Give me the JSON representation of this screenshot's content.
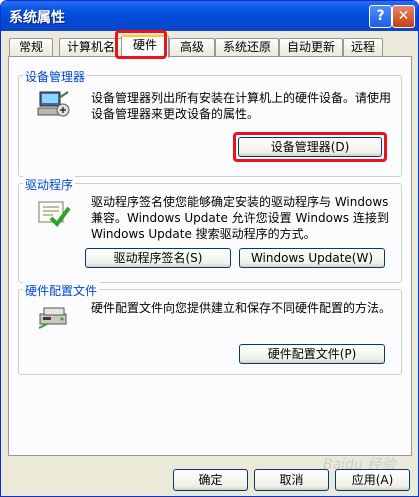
{
  "window": {
    "title": "系统属性",
    "help_glyph": "?",
    "close_glyph": "✕"
  },
  "tabs": [
    {
      "label": "常规",
      "active": false
    },
    {
      "label": "计算机名",
      "active": false
    },
    {
      "label": "硬件",
      "active": true
    },
    {
      "label": "高级",
      "active": false
    },
    {
      "label": "系统还原",
      "active": false
    },
    {
      "label": "自动更新",
      "active": false
    },
    {
      "label": "远程",
      "active": false
    }
  ],
  "device_manager": {
    "group_label": "设备管理器",
    "description": "设备管理器列出所有安装在计算机上的硬件设备。请使用设备管理器来更改设备的属性。",
    "button_label": "设备管理器(D)",
    "icon": "device-manager-icon"
  },
  "drivers": {
    "group_label": "驱动程序",
    "description": "驱动程序签名使您能够确定安装的驱动程序与 Windows 兼容。Windows Update 允许您设置 Windows 连接到 Windows Update 搜索驱动程序的方式。",
    "signing_button_label": "驱动程序签名(S)",
    "update_button_label": "Windows Update(W)",
    "icon": "driver-signing-icon"
  },
  "hardware_profiles": {
    "group_label": "硬件配置文件",
    "description": "硬件配置文件向您提供建立和保存不同硬件配置的方法。",
    "button_label": "硬件配置文件(P)",
    "icon": "hardware-profile-icon"
  },
  "footer": {
    "ok_label": "确定",
    "cancel_label": "取消",
    "apply_label": "应用(A)"
  },
  "watermark": "Baidu 经验",
  "colors": {
    "titlebar": "#0a58e8",
    "group_label": "#0046d5",
    "highlight": "#e8141b",
    "panel": "#fcfcfe",
    "window_bg": "#ece9d8"
  }
}
